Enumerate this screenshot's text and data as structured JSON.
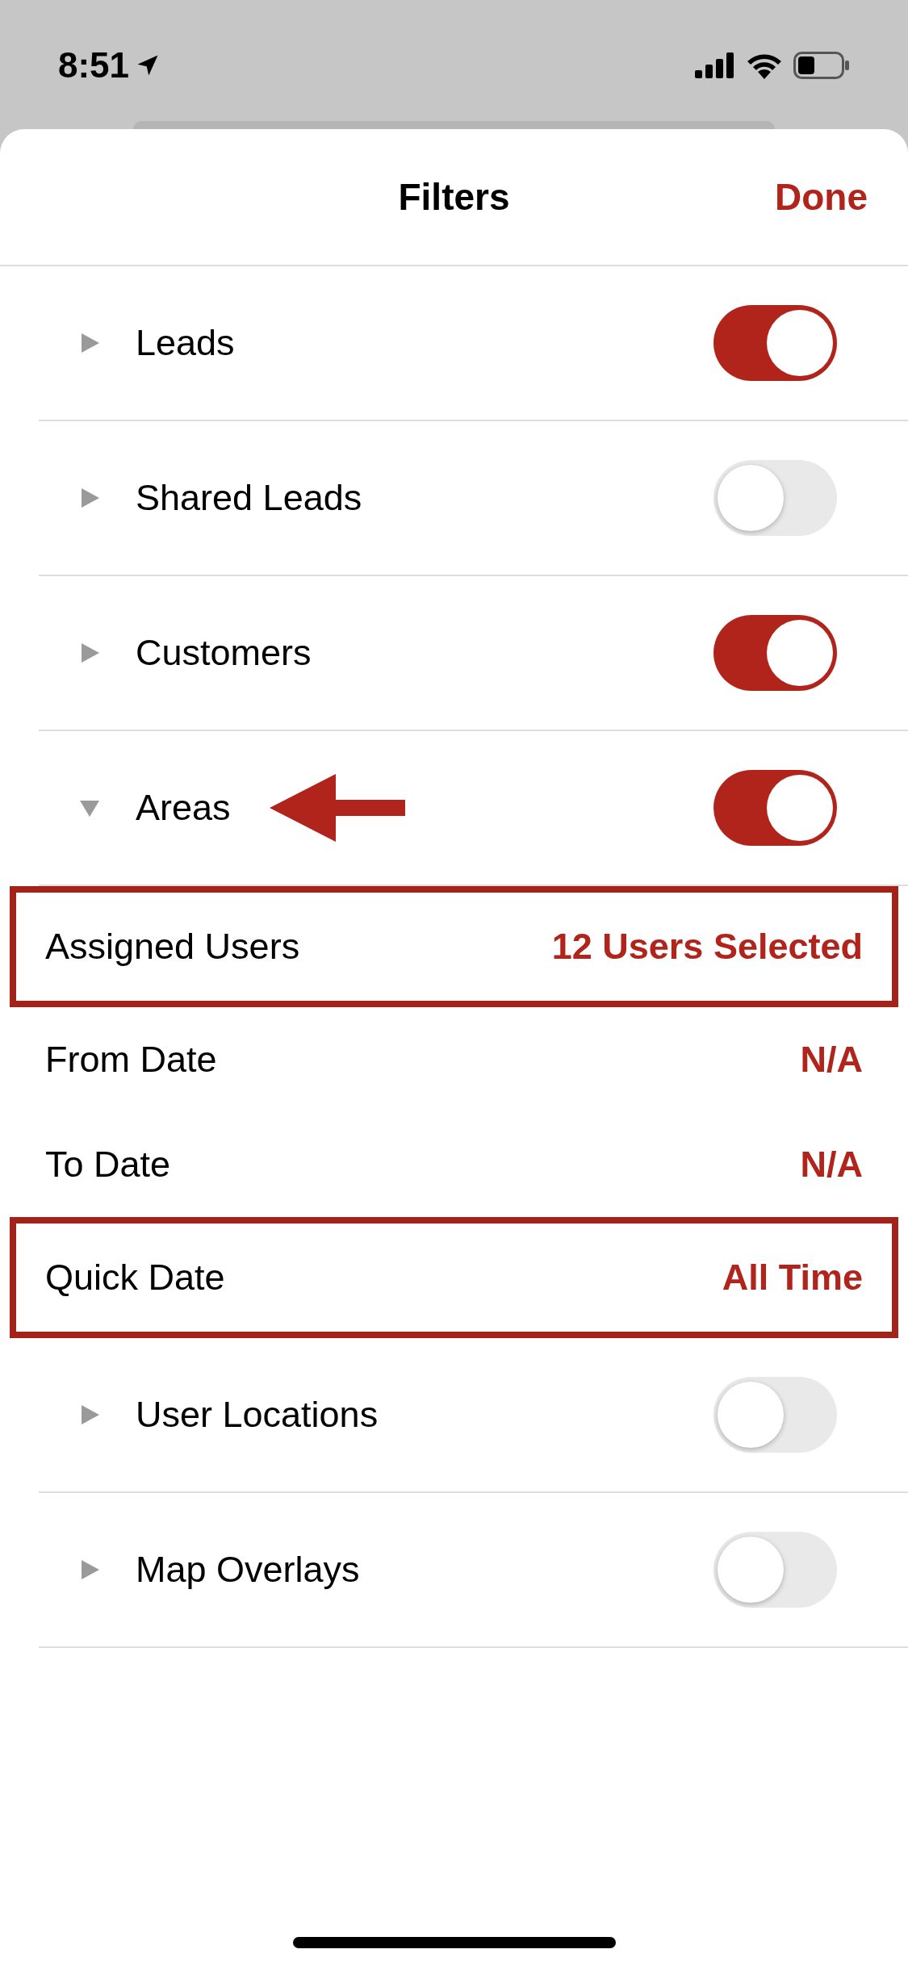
{
  "status_bar": {
    "time": "8:51"
  },
  "header": {
    "title": "Filters",
    "done": "Done"
  },
  "rows": [
    {
      "kind": "toggle",
      "label": "Leads",
      "on": true,
      "expanded": false,
      "pointer": false
    },
    {
      "kind": "toggle",
      "label": "Shared Leads",
      "on": false,
      "expanded": false,
      "pointer": false
    },
    {
      "kind": "toggle",
      "label": "Customers",
      "on": true,
      "expanded": false,
      "pointer": false
    },
    {
      "kind": "toggle",
      "label": "Areas",
      "on": true,
      "expanded": true,
      "pointer": true
    },
    {
      "kind": "setting",
      "label": "Assigned Users",
      "value": "12 Users Selected",
      "highlighted": true
    },
    {
      "kind": "setting",
      "label": "From Date",
      "value": "N/A",
      "highlighted": false
    },
    {
      "kind": "setting",
      "label": "To Date",
      "value": "N/A",
      "highlighted": false
    },
    {
      "kind": "setting",
      "label": "Quick Date",
      "value": "All Time",
      "highlighted": true
    },
    {
      "kind": "toggle",
      "label": "User Locations",
      "on": false,
      "expanded": false,
      "pointer": false
    },
    {
      "kind": "toggle",
      "label": "Map Overlays",
      "on": false,
      "expanded": false,
      "pointer": false
    }
  ]
}
